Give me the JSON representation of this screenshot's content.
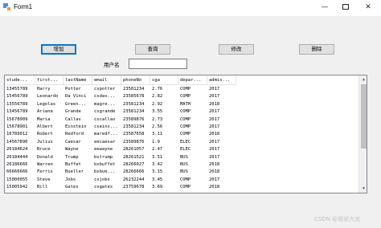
{
  "window": {
    "title": "Form1"
  },
  "titlebar": {
    "min_glyph": "—",
    "close_glyph": "✕"
  },
  "toolbar": {
    "add_label": "增加",
    "query_label": "查询",
    "edit_label": "修改",
    "delete_label": "删除"
  },
  "username": {
    "label": "用户名",
    "value": ""
  },
  "grid": {
    "columns": [
      "stude...",
      "first...",
      "lastName",
      "email",
      "phoneNo",
      "cga",
      "depar...",
      "admis..."
    ],
    "rows": [
      [
        "13455789",
        "Harry",
        "Potter",
        "cspotter",
        "23581234",
        "2.76",
        "COMP",
        "2017"
      ],
      [
        "15456789",
        "Leonardo",
        "Da Vinci",
        "csdav...",
        "23585678",
        "2.82",
        "COMP",
        "2017"
      ],
      [
        "13556789",
        "Legolas",
        "Green...",
        "magre...",
        "23581234",
        "2.92",
        "MATH",
        "2018"
      ],
      [
        "13456789",
        "Ariana",
        "Grande",
        "csgrande",
        "23581234",
        "3.55",
        "COMP",
        "2017"
      ],
      [
        "15678909",
        "Maria",
        "Callas",
        "cscallas",
        "23589876",
        "2.73",
        "COMP",
        "2017"
      ],
      [
        "15678901",
        "Albert",
        "Einstein",
        "cseins...",
        "23581234",
        "2.56",
        "COMP",
        "2017"
      ],
      [
        "16789012",
        "Robert",
        "Redford",
        "maredf...",
        "23587658",
        "3.11",
        "COMP",
        "2018"
      ],
      [
        "14567890",
        "Julius",
        "Caesar",
        "eecaesar",
        "23589876",
        "1.9",
        "ELEC",
        "2017"
      ],
      [
        "26184624",
        "Bruce",
        "Wayne",
        "eewayne",
        "28261057",
        "2.47",
        "ELEC",
        "2017"
      ],
      [
        "26184444",
        "Donald",
        "Trump",
        "bstrump",
        "28261521",
        "3.51",
        "BUS",
        "2017"
      ],
      [
        "26186666",
        "Warren",
        "Buffet",
        "bsbuffet",
        "28266027",
        "3.42",
        "BUS",
        "2018"
      ],
      [
        "66666666",
        "Ferris",
        "Bueller",
        "bsbue...",
        "28266666",
        "3.15",
        "BUS",
        "2018"
      ],
      [
        "15000055",
        "Steve",
        "Jobs",
        "csjobs",
        "26232244",
        "3.45",
        "COMP",
        "2017"
      ],
      [
        "15005942",
        "Bill",
        "Gates",
        "csgates",
        "23759678",
        "3.69",
        "COMP",
        "2018"
      ]
    ]
  },
  "watermark": "CSDN @祖安大龙"
}
